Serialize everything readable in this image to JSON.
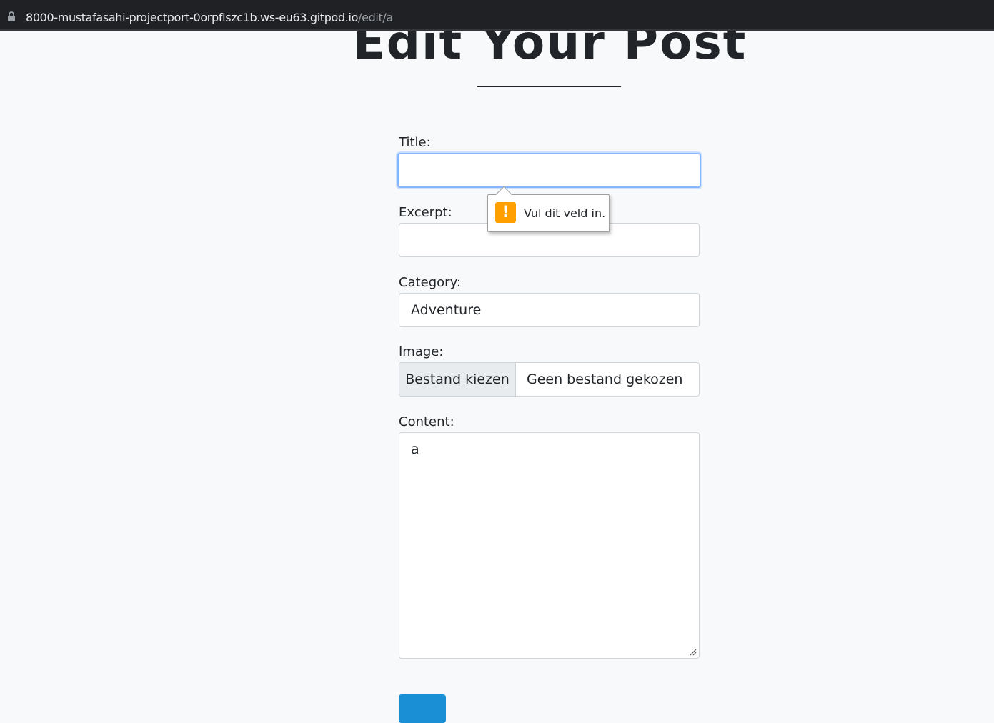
{
  "browser": {
    "url_host": "8000-mustafasahi-projectport-0orpflszc1b.ws-eu63.gitpod.io",
    "url_path": "/edit/a"
  },
  "page": {
    "heading": "Edit Your Post"
  },
  "form": {
    "title_label": "Title:",
    "title_value": "",
    "excerpt_label": "Excerpt:",
    "excerpt_value": "",
    "category_label": "Category:",
    "category_value": "Adventure",
    "image_label": "Image:",
    "image_button": "Bestand kiezen",
    "image_status": "Geen bestand gekozen",
    "content_label": "Content:",
    "content_value": "a"
  },
  "validation": {
    "message": "Vul dit veld in.",
    "icon": "warning-icon",
    "icon_color": "#ffa000"
  },
  "colors": {
    "focus_border": "#86b7fe",
    "submit_button": "#1a8fd6",
    "background": "#f8f9fa"
  }
}
